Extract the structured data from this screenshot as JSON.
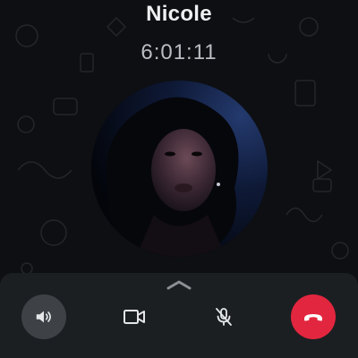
{
  "call": {
    "contact_name": "Nicole",
    "duration": "6:01:11"
  },
  "controls": {
    "speaker_icon": "speaker-icon",
    "video_icon": "video-camera-icon",
    "mute_icon": "microphone-off-icon",
    "end_icon": "phone-hangup-icon"
  },
  "colors": {
    "end_call": "#e3263f",
    "speaker_active_bg": "#3e4246",
    "panel_bg": "#1c1f22"
  }
}
